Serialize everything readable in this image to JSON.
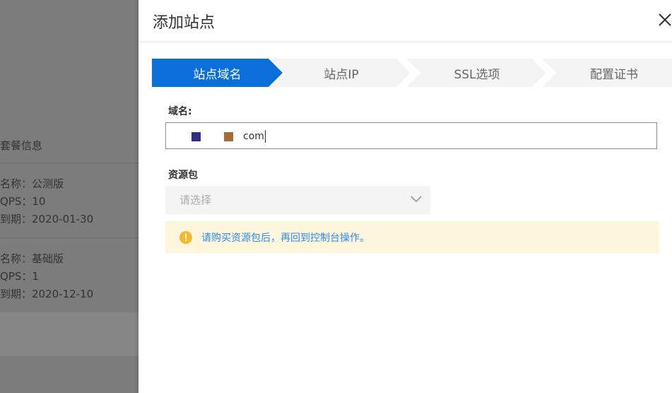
{
  "background": {
    "section_title": "套餐信息",
    "plans": [
      {
        "name": "名称：公测版",
        "qps": "QPS：10",
        "expiry": "到期：2020-01-30"
      },
      {
        "name": "名称：基础版",
        "qps": "QPS：1",
        "expiry": "到期：2020-12-10"
      }
    ]
  },
  "drawer": {
    "title": "添加站点",
    "steps": [
      {
        "label": "站点域名",
        "active": true
      },
      {
        "label": "站点IP",
        "active": false
      },
      {
        "label": "SSL选项",
        "active": false
      },
      {
        "label": "配置证书",
        "active": false
      }
    ],
    "domain_label": "域名:",
    "domain_value_suffix": "com",
    "package_label": "资源包",
    "package_placeholder": "请选择",
    "notice": "请购买资源包后，再回到控制台操作。"
  },
  "colors": {
    "accent": "#0a6fd8",
    "step_inactive_bg": "#f4f4f4",
    "notice_bg": "#fdf6dd",
    "notice_text": "#2d8cf0",
    "warning_icon": "#f5b82e"
  }
}
